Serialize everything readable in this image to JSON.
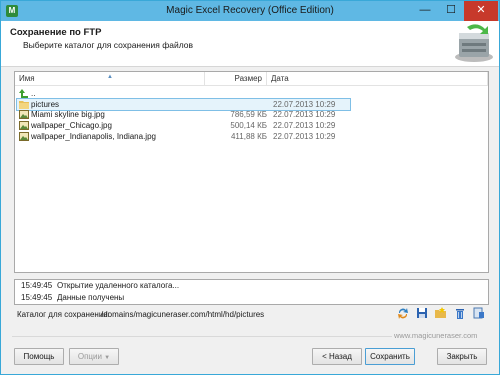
{
  "window": {
    "title": "Magic Excel Recovery (Office Edition)",
    "minimize": "—",
    "maximize": "☐",
    "close": "✕",
    "app_icon": "M"
  },
  "header": {
    "title": "Сохранение по FTP",
    "subtitle": "Выберите каталог для сохранения файлов",
    "icon": "ftp-server-icon"
  },
  "list": {
    "columns": [
      "Имя",
      "Размер",
      "Дата"
    ],
    "up_label": "..",
    "rows": [
      {
        "name": "pictures",
        "size": "",
        "date": "22.07.2013 10:29",
        "type": "folder",
        "selected": true
      },
      {
        "name": "Miami skyline big.jpg",
        "size": "786,59 КБ",
        "date": "22.07.2013 10:29",
        "type": "image"
      },
      {
        "name": "wallpaper_Chicago.jpg",
        "size": "500,14 КБ",
        "date": "22.07.2013 10:29",
        "type": "image"
      },
      {
        "name": "wallpaper_Indianapolis, Indiana.jpg",
        "size": "411,88 КБ",
        "date": "22.07.2013 10:29",
        "type": "image"
      }
    ]
  },
  "log": [
    {
      "time": "15:49:45",
      "message": "Открытие удаленного каталога..."
    },
    {
      "time": "15:49:45",
      "message": "Данные получены"
    }
  ],
  "path": {
    "label": "Каталог для сохранения:",
    "value": "/domains/magicuneraser.com/html/hd/pictures"
  },
  "toolbar_icons": [
    "refresh-icon",
    "save-icon",
    "new-folder-icon",
    "delete-icon",
    "properties-icon"
  ],
  "website": "www.magicuneraser.com",
  "buttons": {
    "help": "Помощь",
    "options": "Опции",
    "back": "< Назад",
    "save": "Сохранить",
    "close": "Закрыть"
  }
}
